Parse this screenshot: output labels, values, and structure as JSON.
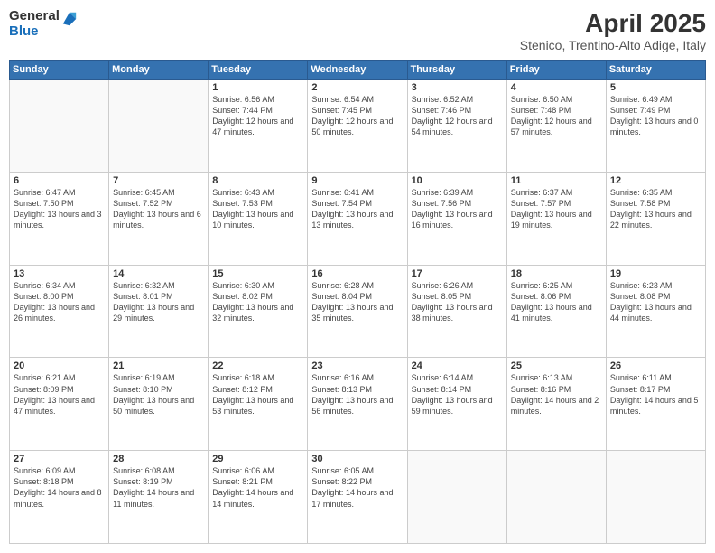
{
  "logo": {
    "general": "General",
    "blue": "Blue"
  },
  "title": "April 2025",
  "subtitle": "Stenico, Trentino-Alto Adige, Italy",
  "headers": [
    "Sunday",
    "Monday",
    "Tuesday",
    "Wednesday",
    "Thursday",
    "Friday",
    "Saturday"
  ],
  "weeks": [
    [
      {
        "day": "",
        "info": ""
      },
      {
        "day": "",
        "info": ""
      },
      {
        "day": "1",
        "info": "Sunrise: 6:56 AM\nSunset: 7:44 PM\nDaylight: 12 hours and 47 minutes."
      },
      {
        "day": "2",
        "info": "Sunrise: 6:54 AM\nSunset: 7:45 PM\nDaylight: 12 hours and 50 minutes."
      },
      {
        "day": "3",
        "info": "Sunrise: 6:52 AM\nSunset: 7:46 PM\nDaylight: 12 hours and 54 minutes."
      },
      {
        "day": "4",
        "info": "Sunrise: 6:50 AM\nSunset: 7:48 PM\nDaylight: 12 hours and 57 minutes."
      },
      {
        "day": "5",
        "info": "Sunrise: 6:49 AM\nSunset: 7:49 PM\nDaylight: 13 hours and 0 minutes."
      }
    ],
    [
      {
        "day": "6",
        "info": "Sunrise: 6:47 AM\nSunset: 7:50 PM\nDaylight: 13 hours and 3 minutes."
      },
      {
        "day": "7",
        "info": "Sunrise: 6:45 AM\nSunset: 7:52 PM\nDaylight: 13 hours and 6 minutes."
      },
      {
        "day": "8",
        "info": "Sunrise: 6:43 AM\nSunset: 7:53 PM\nDaylight: 13 hours and 10 minutes."
      },
      {
        "day": "9",
        "info": "Sunrise: 6:41 AM\nSunset: 7:54 PM\nDaylight: 13 hours and 13 minutes."
      },
      {
        "day": "10",
        "info": "Sunrise: 6:39 AM\nSunset: 7:56 PM\nDaylight: 13 hours and 16 minutes."
      },
      {
        "day": "11",
        "info": "Sunrise: 6:37 AM\nSunset: 7:57 PM\nDaylight: 13 hours and 19 minutes."
      },
      {
        "day": "12",
        "info": "Sunrise: 6:35 AM\nSunset: 7:58 PM\nDaylight: 13 hours and 22 minutes."
      }
    ],
    [
      {
        "day": "13",
        "info": "Sunrise: 6:34 AM\nSunset: 8:00 PM\nDaylight: 13 hours and 26 minutes."
      },
      {
        "day": "14",
        "info": "Sunrise: 6:32 AM\nSunset: 8:01 PM\nDaylight: 13 hours and 29 minutes."
      },
      {
        "day": "15",
        "info": "Sunrise: 6:30 AM\nSunset: 8:02 PM\nDaylight: 13 hours and 32 minutes."
      },
      {
        "day": "16",
        "info": "Sunrise: 6:28 AM\nSunset: 8:04 PM\nDaylight: 13 hours and 35 minutes."
      },
      {
        "day": "17",
        "info": "Sunrise: 6:26 AM\nSunset: 8:05 PM\nDaylight: 13 hours and 38 minutes."
      },
      {
        "day": "18",
        "info": "Sunrise: 6:25 AM\nSunset: 8:06 PM\nDaylight: 13 hours and 41 minutes."
      },
      {
        "day": "19",
        "info": "Sunrise: 6:23 AM\nSunset: 8:08 PM\nDaylight: 13 hours and 44 minutes."
      }
    ],
    [
      {
        "day": "20",
        "info": "Sunrise: 6:21 AM\nSunset: 8:09 PM\nDaylight: 13 hours and 47 minutes."
      },
      {
        "day": "21",
        "info": "Sunrise: 6:19 AM\nSunset: 8:10 PM\nDaylight: 13 hours and 50 minutes."
      },
      {
        "day": "22",
        "info": "Sunrise: 6:18 AM\nSunset: 8:12 PM\nDaylight: 13 hours and 53 minutes."
      },
      {
        "day": "23",
        "info": "Sunrise: 6:16 AM\nSunset: 8:13 PM\nDaylight: 13 hours and 56 minutes."
      },
      {
        "day": "24",
        "info": "Sunrise: 6:14 AM\nSunset: 8:14 PM\nDaylight: 13 hours and 59 minutes."
      },
      {
        "day": "25",
        "info": "Sunrise: 6:13 AM\nSunset: 8:16 PM\nDaylight: 14 hours and 2 minutes."
      },
      {
        "day": "26",
        "info": "Sunrise: 6:11 AM\nSunset: 8:17 PM\nDaylight: 14 hours and 5 minutes."
      }
    ],
    [
      {
        "day": "27",
        "info": "Sunrise: 6:09 AM\nSunset: 8:18 PM\nDaylight: 14 hours and 8 minutes."
      },
      {
        "day": "28",
        "info": "Sunrise: 6:08 AM\nSunset: 8:19 PM\nDaylight: 14 hours and 11 minutes."
      },
      {
        "day": "29",
        "info": "Sunrise: 6:06 AM\nSunset: 8:21 PM\nDaylight: 14 hours and 14 minutes."
      },
      {
        "day": "30",
        "info": "Sunrise: 6:05 AM\nSunset: 8:22 PM\nDaylight: 14 hours and 17 minutes."
      },
      {
        "day": "",
        "info": ""
      },
      {
        "day": "",
        "info": ""
      },
      {
        "day": "",
        "info": ""
      }
    ]
  ]
}
